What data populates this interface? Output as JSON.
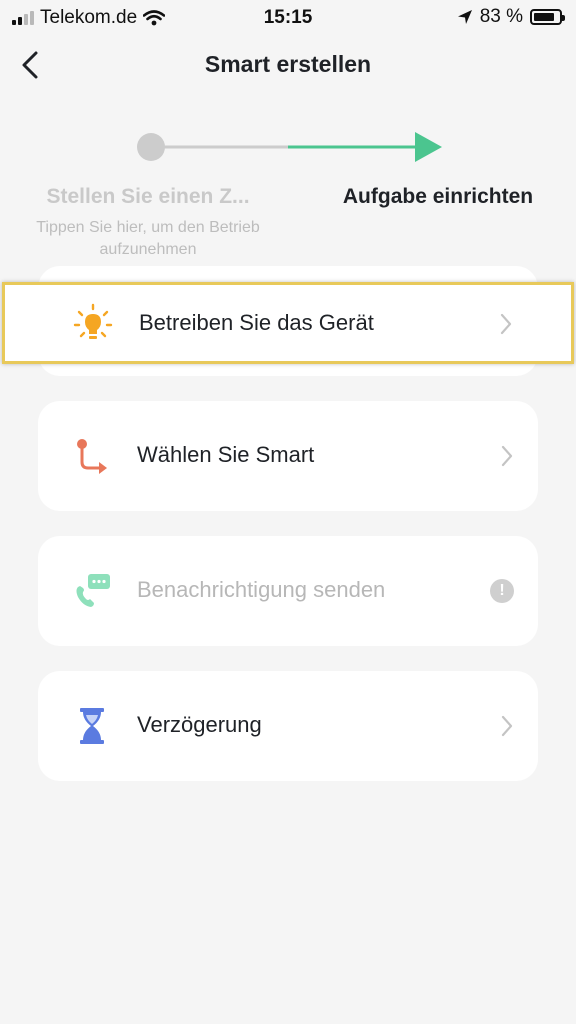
{
  "status_bar": {
    "carrier": "Telekom.de",
    "time": "15:15",
    "battery": "83 %",
    "battery_level": 0.83
  },
  "header": {
    "title": "Smart erstellen"
  },
  "steps": {
    "step1_title": "Stellen Sie einen Z...",
    "step1_subtitle": "Tippen Sie hier, um den Betrieb aufzunehmen",
    "step2_title": "Aufgabe einrichten",
    "colors": {
      "inactive": "#cccccc",
      "active": "#4bc58f"
    }
  },
  "tasks": [
    {
      "label": "Betreiben Sie das Gerät",
      "icon": "bulb-icon",
      "color": "#f5a623",
      "state": "enabled"
    },
    {
      "label": "Wählen Sie Smart",
      "icon": "route-icon",
      "color": "#e8775a",
      "state": "enabled"
    },
    {
      "label": "Benachrichtigung senden",
      "icon": "phone-message-icon",
      "color": "#8ee0bb",
      "state": "disabled"
    },
    {
      "label": "Verzögerung",
      "icon": "hourglass-icon",
      "color": "#5b7be0",
      "state": "enabled"
    }
  ]
}
